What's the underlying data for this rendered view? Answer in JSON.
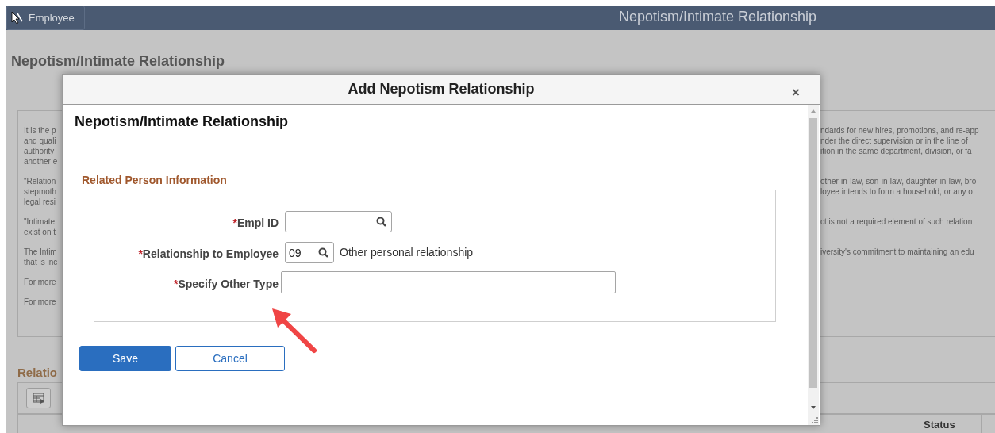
{
  "header": {
    "back_button": "Employee",
    "title": "Nepotism/Intimate Relationship"
  },
  "page": {
    "title": "Nepotism/Intimate Relationship",
    "paragraphs": [
      {
        "lines": [
          {
            "left": "It is the p",
            "right": "ndards for new hires, promotions, and re-app"
          },
          {
            "left": "and quali",
            "right": "nder the direct supervision or in the line of"
          },
          {
            "left": "authority",
            "right": "ition in the same department, division, or fa"
          },
          {
            "left": "another e"
          }
        ]
      },
      {
        "lines": [
          {
            "left": "\"Relation",
            "right": "other-in-law, son-in-law, daughter-in-law, bro"
          },
          {
            "left": "stepmoth",
            "right": "loyee intends to form a household, or any o"
          },
          {
            "left": "legal resi"
          }
        ]
      },
      {
        "lines": [
          {
            "left": "\"Intimate",
            "right": "ct is not a required element of such relation"
          },
          {
            "left": "exist on t"
          }
        ]
      },
      {
        "lines": [
          {
            "left": "The Intim",
            "right": "iversity's commitment to maintaining an edu"
          },
          {
            "left": "that is inc"
          }
        ]
      },
      {
        "lines": [
          {
            "left": "For more"
          }
        ]
      },
      {
        "lines": [
          {
            "left": "For more"
          }
        ]
      }
    ],
    "section_title": "Relatio",
    "status_column": "Status"
  },
  "dialog": {
    "title": "Add Nepotism Relationship",
    "close": "×",
    "heading": "Nepotism/Intimate Relationship",
    "section": "Related Person Information",
    "fields": [
      {
        "kind": "lookup",
        "marker": "*",
        "label": "Empl ID"
      },
      {
        "kind": "lookup",
        "marker": "*",
        "label": "Relationship to Employee",
        "value": "09",
        "description": "Other personal relationship"
      },
      {
        "kind": "text",
        "marker": "*",
        "label": "Specify Other Type"
      }
    ],
    "buttons": [
      {
        "kind": "primary",
        "label": "Save"
      },
      {
        "kind": "secondary",
        "label": "Cancel"
      }
    ]
  }
}
